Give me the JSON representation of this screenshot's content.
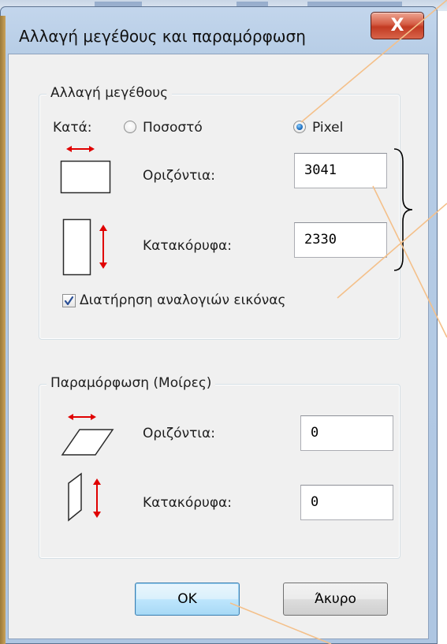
{
  "window": {
    "title": "Αλλαγή μεγέθους και παραμόρφωση",
    "close_label": "X"
  },
  "resize": {
    "legend": "Αλλαγή μεγέθους",
    "by_label": "Κατά:",
    "percent_label": "Ποσοστό",
    "pixel_label": "Pixel",
    "selected_unit": "Pixel",
    "horizontal_label": "Οριζόντια:",
    "horizontal_value": "3041",
    "vertical_label": "Κατακόρυφα:",
    "vertical_value": "2330",
    "keep_ratio_label": "Διατήρηση αναλογιών εικόνας",
    "keep_ratio_checked": true
  },
  "skew": {
    "legend": "Παραμόρφωση (Μοίρες)",
    "horizontal_label": "Οριζόντια:",
    "horizontal_value": "0",
    "vertical_label": "Κατακόρυφα:",
    "vertical_value": "0"
  },
  "buttons": {
    "ok_label": "OK",
    "cancel_label": "Άκυρο"
  },
  "colors": {
    "accent_arrow": "#e00000",
    "annotation_line": "#f4c08a",
    "close_button": "#c74a33"
  },
  "icons": [
    "close-icon",
    "horizontal-resize-icon",
    "vertical-resize-icon",
    "horizontal-skew-icon",
    "vertical-skew-icon",
    "checkmark-icon"
  ]
}
